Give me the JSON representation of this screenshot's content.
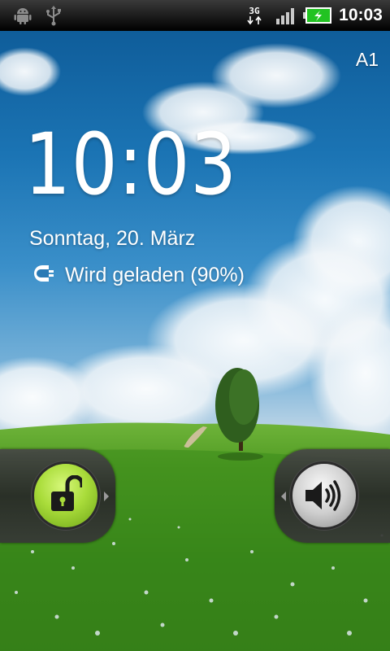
{
  "status_bar": {
    "time": "10:03",
    "network_type": "3G",
    "icons": [
      "android-debug-icon",
      "usb-icon",
      "3g-data-icon",
      "signal-strength-icon",
      "battery-charging-icon"
    ],
    "battery_color": "#22c322"
  },
  "lockscreen": {
    "carrier": "A1",
    "clock": "10:03",
    "date": "Sonntag, 20. März",
    "charging_status": "Wird geladen (90%)",
    "charge_percent": 90,
    "unlock_tab": {
      "icon": "unlock-icon",
      "color": "#a9dc3a"
    },
    "sound_tab": {
      "icon": "speaker-icon",
      "color": "#c8c8c8"
    }
  }
}
